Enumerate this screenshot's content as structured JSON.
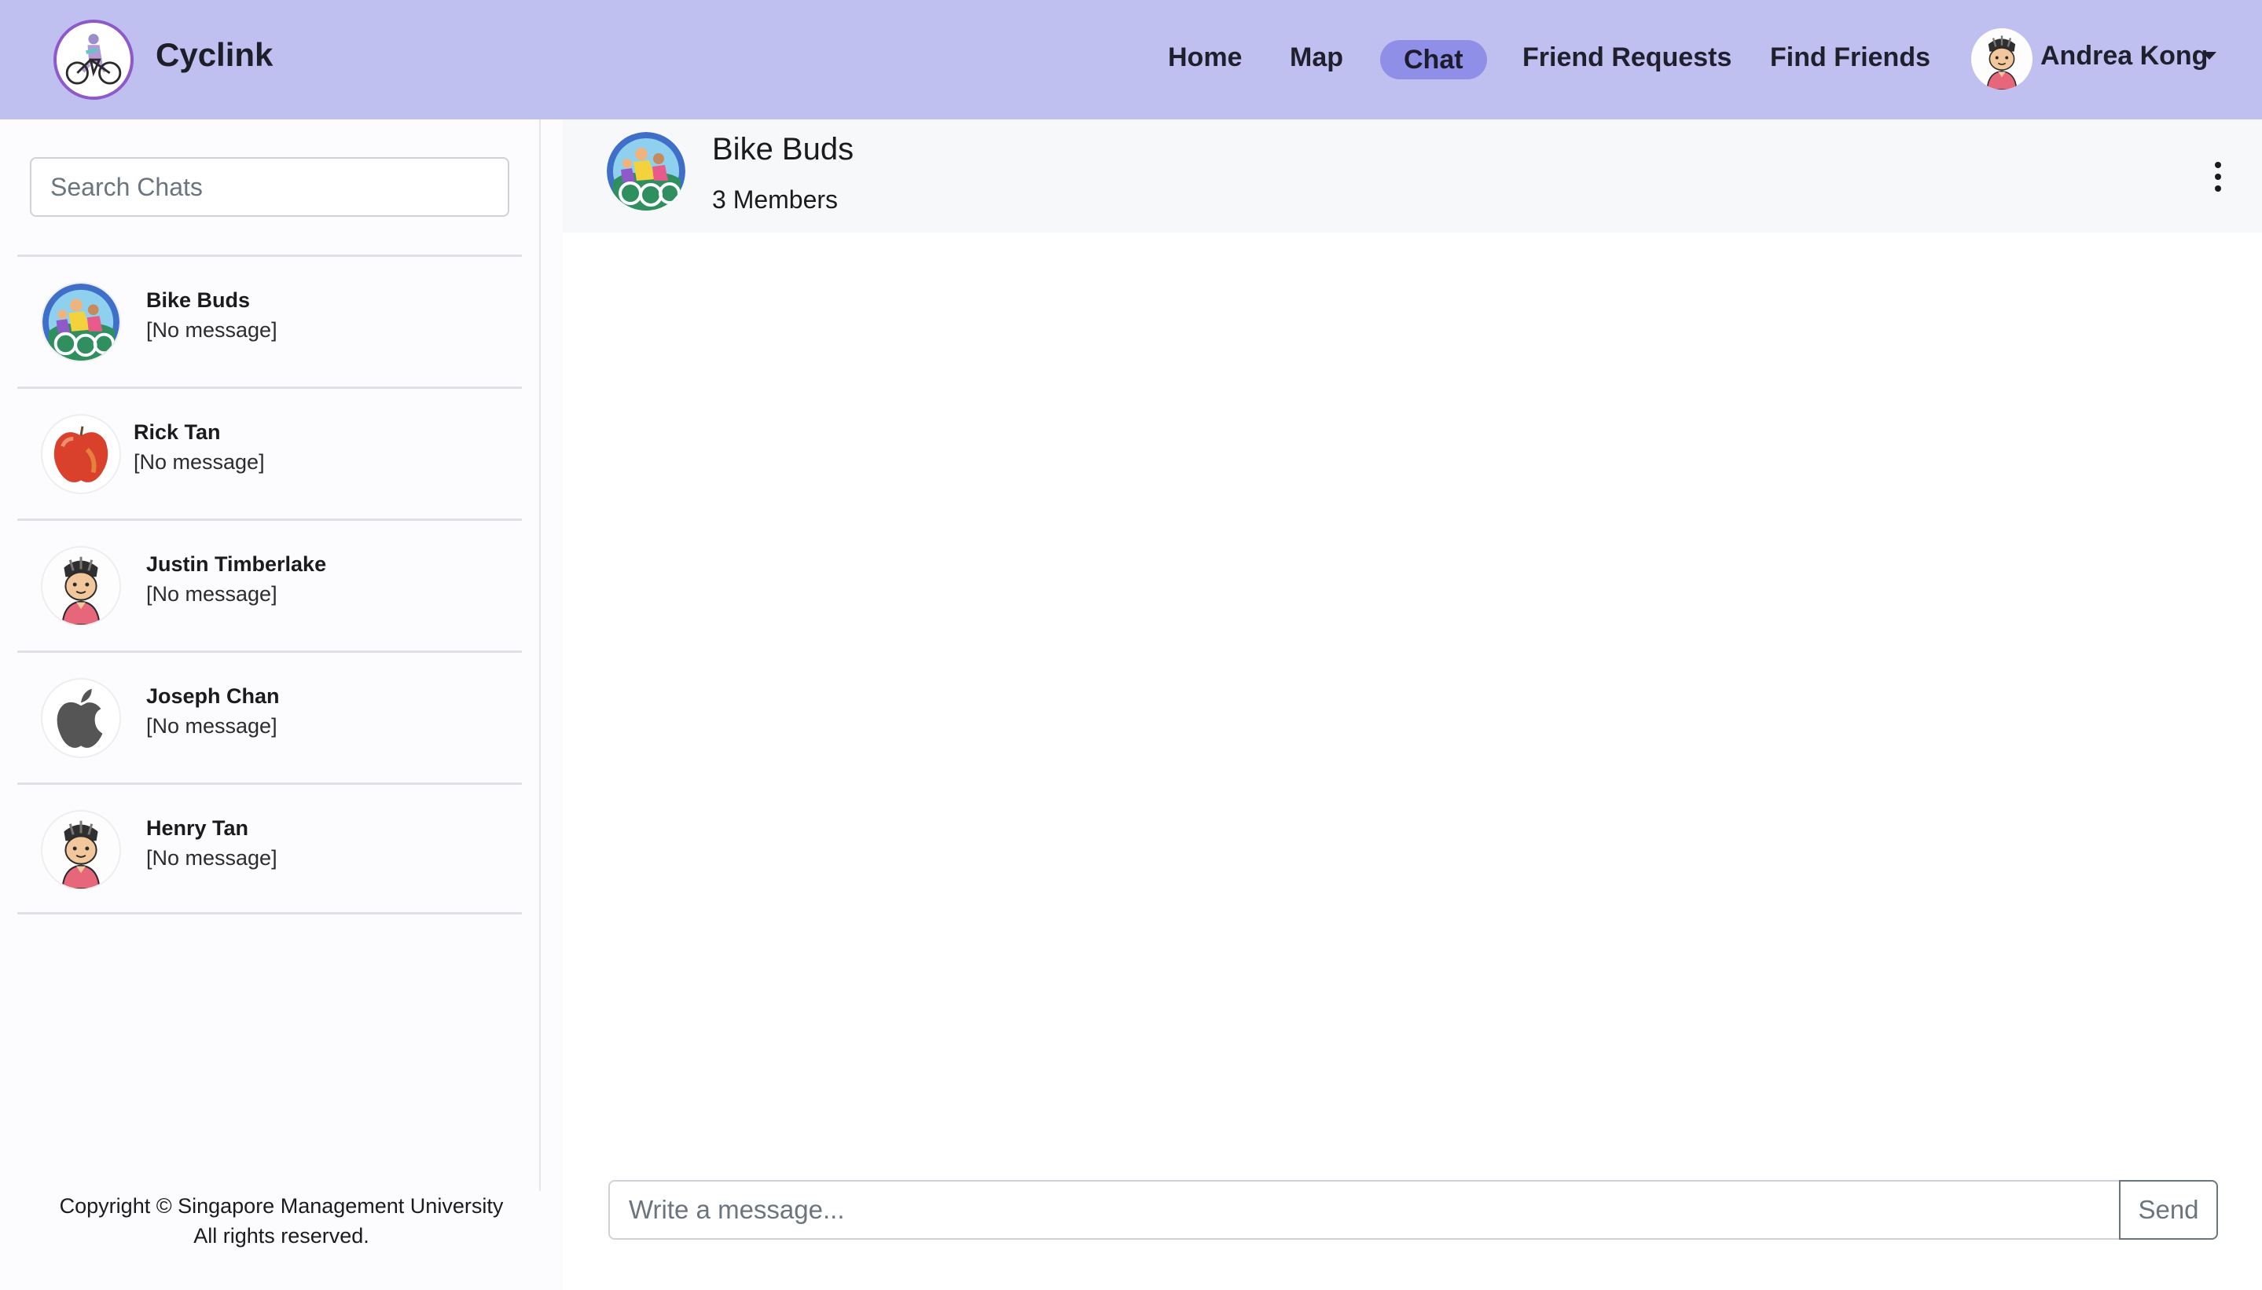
{
  "app": {
    "name": "Cyclink",
    "logo_icon": "cyclist-on-bike-icon"
  },
  "nav": {
    "links": [
      {
        "label": "Home",
        "active": false
      },
      {
        "label": "Map",
        "active": false
      },
      {
        "label": "Chat",
        "active": true
      },
      {
        "label": "Friend Requests",
        "active": false
      },
      {
        "label": "Find Friends",
        "active": false
      }
    ],
    "user": {
      "name": "Andrea Kong",
      "avatar_icon": "cyclist-helmet-avatar-icon"
    }
  },
  "sidebar": {
    "search": {
      "placeholder": "Search Chats",
      "value": ""
    },
    "chats": [
      {
        "name": "Bike Buds",
        "preview": "[No message]",
        "avatar_icon": "group-cyclists-avatar-icon"
      },
      {
        "name": "Rick Tan",
        "preview": "[No message]",
        "avatar_icon": "apple-fruit-avatar-icon"
      },
      {
        "name": "Justin Timberlake",
        "preview": "[No message]",
        "avatar_icon": "cyclist-helmet-avatar-icon"
      },
      {
        "name": "Joseph Chan",
        "preview": "[No message]",
        "avatar_icon": "apple-logo-avatar-icon"
      },
      {
        "name": "Henry Tan",
        "preview": "[No message]",
        "avatar_icon": "cyclist-helmet-avatar-icon"
      }
    ],
    "footer": {
      "line1": "Copyright © Singapore Management University",
      "line2": "All rights reserved."
    }
  },
  "chat": {
    "title": "Bike Buds",
    "subtitle": "3 Members",
    "avatar_icon": "group-cyclists-avatar-icon",
    "menu_icon": "kebab-menu-icon",
    "composer": {
      "placeholder": "Write a message...",
      "value": "",
      "send_label": "Send"
    }
  },
  "colors": {
    "navbar_bg": "#bfbff0",
    "active_pill": "#8f8fe7",
    "logo_ring": "#8e59c9",
    "sidebar_bg": "#fcfbfe",
    "header_bg": "#f7f8fa"
  }
}
